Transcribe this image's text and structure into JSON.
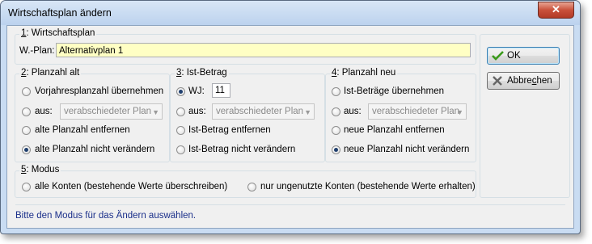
{
  "window": {
    "title": "Wirtschaftsplan ändern",
    "close_label": "✕"
  },
  "group1": {
    "num": "1",
    "title": ": Wirtschaftsplan",
    "field_label": "W.-Plan:",
    "field_value": "Alternativplan 1"
  },
  "group2": {
    "num": "2",
    "title": ": Planzahl alt",
    "opt1": "Vorjahresplanzahl übernehmen",
    "opt2": "aus:",
    "combo": "verabschiedeter Plan",
    "opt3": "alte Planzahl entfernen",
    "opt4": "alte Planzahl nicht verändern",
    "selected": 4
  },
  "group3": {
    "num": "3",
    "title": ": Ist-Betrag",
    "opt1": "WJ:",
    "wj_value": "11",
    "opt2": "aus:",
    "combo": "verabschiedeter Plan",
    "opt3": "Ist-Betrag entfernen",
    "opt4": "Ist-Betrag nicht verändern",
    "selected": 1
  },
  "group4": {
    "num": "4",
    "title": ": Planzahl neu",
    "opt1": "Ist-Beträge übernehmen",
    "opt2": "aus:",
    "combo": "verabschiedeter Plan",
    "opt3": "neue Planzahl entfernen",
    "opt4": "neue Planzahl nicht verändern",
    "selected": 4
  },
  "group5": {
    "num": "5",
    "title": ": Modus",
    "opt1": "alle Konten (bestehende Werte überschreiben)",
    "opt2": "nur ungenutzte Konten (bestehende Werte erhalten)"
  },
  "buttons": {
    "ok": "OK",
    "cancel_pre": "Abbre",
    "cancel_u": "c",
    "cancel_post": "hen"
  },
  "status": "Bitte den Modus für das Ändern auswählen.",
  "colors": {
    "field_bg": "#ffffc4",
    "status_text": "#1a2f8a"
  }
}
